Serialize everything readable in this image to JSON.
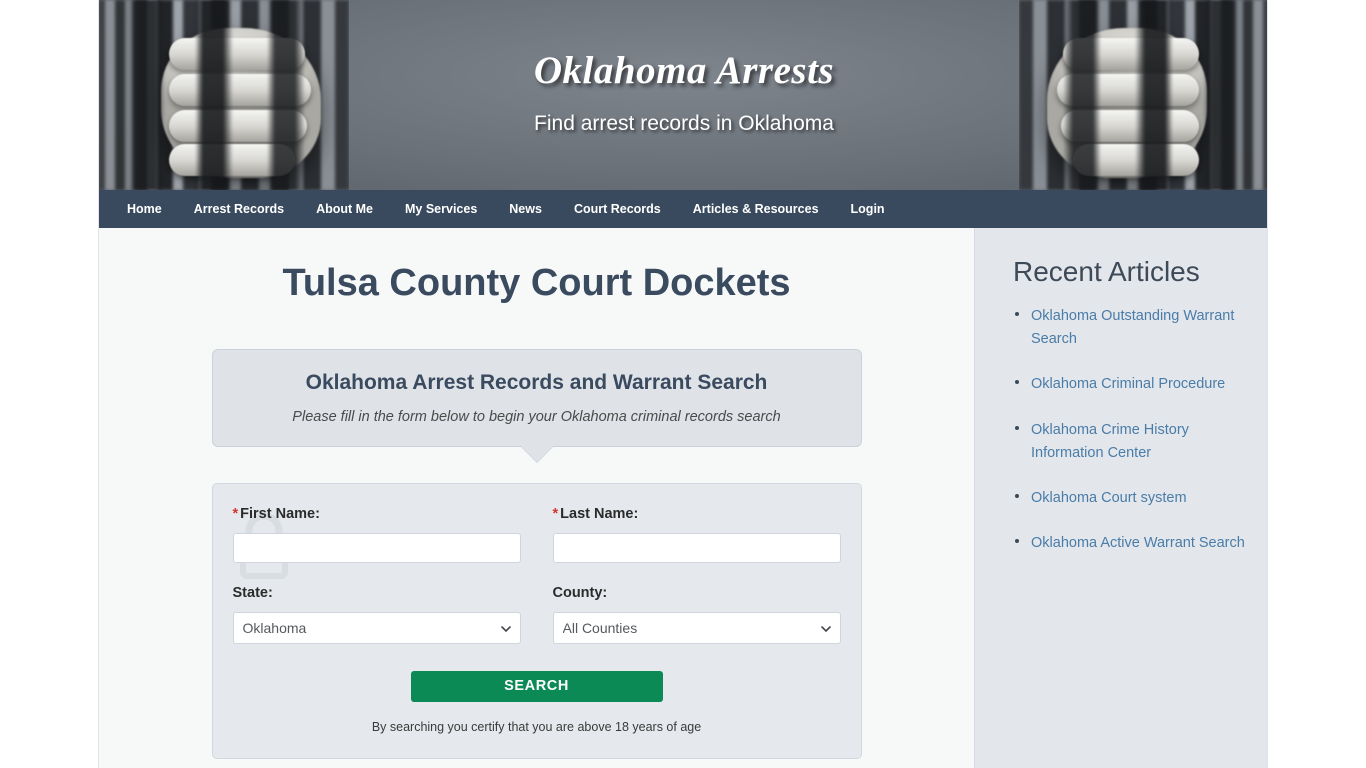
{
  "banner": {
    "site_title": "Oklahoma Arrests",
    "tagline": "Find arrest records in Oklahoma",
    "left_image_name": "hands-gripping-prison-bars",
    "right_image_name": "hands-gripping-prison-bars-mirrored"
  },
  "nav": {
    "items": [
      {
        "label": "Home"
      },
      {
        "label": "Arrest Records"
      },
      {
        "label": "About Me"
      },
      {
        "label": "My Services"
      },
      {
        "label": "News"
      },
      {
        "label": "Court Records"
      },
      {
        "label": "Articles & Resources"
      },
      {
        "label": "Login"
      }
    ]
  },
  "main": {
    "page_title": "Tulsa County Court Dockets",
    "bubble": {
      "title": "Oklahoma Arrest Records and Warrant Search",
      "subtitle": "Please fill in the form below to begin your Oklahoma criminal records search"
    },
    "form": {
      "watermark_icon": "padlock-icon",
      "required_marker": "*",
      "first_name": {
        "label": "First Name:",
        "value": "",
        "placeholder": ""
      },
      "last_name": {
        "label": "Last Name:",
        "value": "",
        "placeholder": ""
      },
      "state": {
        "label": "State:",
        "selected": "Oklahoma",
        "options": [
          "Oklahoma"
        ]
      },
      "county": {
        "label": "County:",
        "selected": "All Counties",
        "options": [
          "All Counties"
        ]
      },
      "search_button": "SEARCH",
      "age_note": "By searching you certify that you are above 18 years of age"
    }
  },
  "sidebar": {
    "title": "Recent Articles",
    "articles": [
      {
        "label": "Oklahoma Outstanding Warrant Search"
      },
      {
        "label": "Oklahoma Criminal Procedure"
      },
      {
        "label": "Oklahoma Crime History Information Center"
      },
      {
        "label": "Oklahoma Court system"
      },
      {
        "label": "Oklahoma Active Warrant Search"
      }
    ]
  },
  "colors": {
    "nav_background": "#2a3c52",
    "heading_text": "#3a4a5f",
    "search_button": "#0b8a56",
    "link": "#4a7ca8",
    "required_star": "#d9342b",
    "sidebar_background": "#e3e7ec",
    "form_background": "#e5e9ed",
    "bubble_background": "#dfe3e8"
  }
}
